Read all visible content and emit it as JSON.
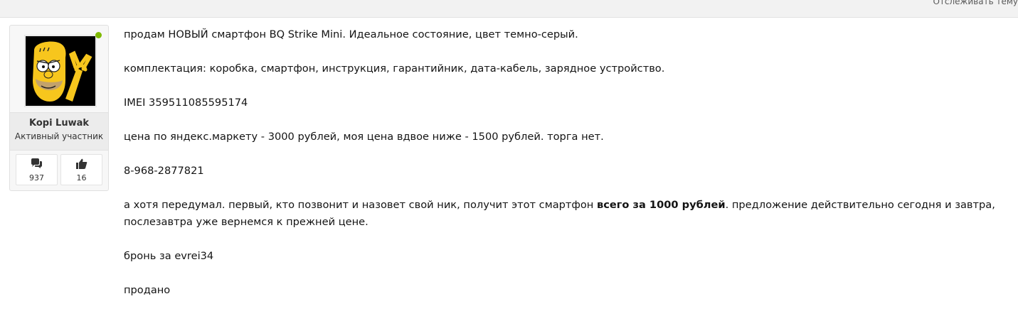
{
  "topbar": {
    "follow_label": "Отслеживать тему"
  },
  "author": {
    "username": "Kopi Luwak",
    "title": "Активный участник",
    "posts_count": "937",
    "likes_count": "16",
    "status_color": "#7fba00"
  },
  "icons": {
    "posts": "speech-bubbles-icon",
    "likes": "thumbs-up-icon"
  },
  "post": {
    "line1": "продам НОВЫЙ смартфон BQ Strike Mini. Идеальное состояние, цвет темно-серый.",
    "line2": "комплектация: коробка, смартфон, инструкция, гарантийник, дата-кабель, зарядное устройство.",
    "line3": "IMEI 359511085595174",
    "line4": "цена по яндекс.маркету - 3000 рублей, моя цена вдвое ниже - 1500 рублей. торга нет.",
    "line5": "8-968-2877821",
    "line6_before": "а хотя передумал. первый, кто позвонит и назовет свой ник, получит этот смартфон ",
    "line6_bold": "всего за 1000 рублей",
    "line6_after": ". предложение действительно сегодня и завтра, послезавтра уже вернемся к прежней цене.",
    "line7": "бронь за evrei34",
    "line8": "продано"
  }
}
